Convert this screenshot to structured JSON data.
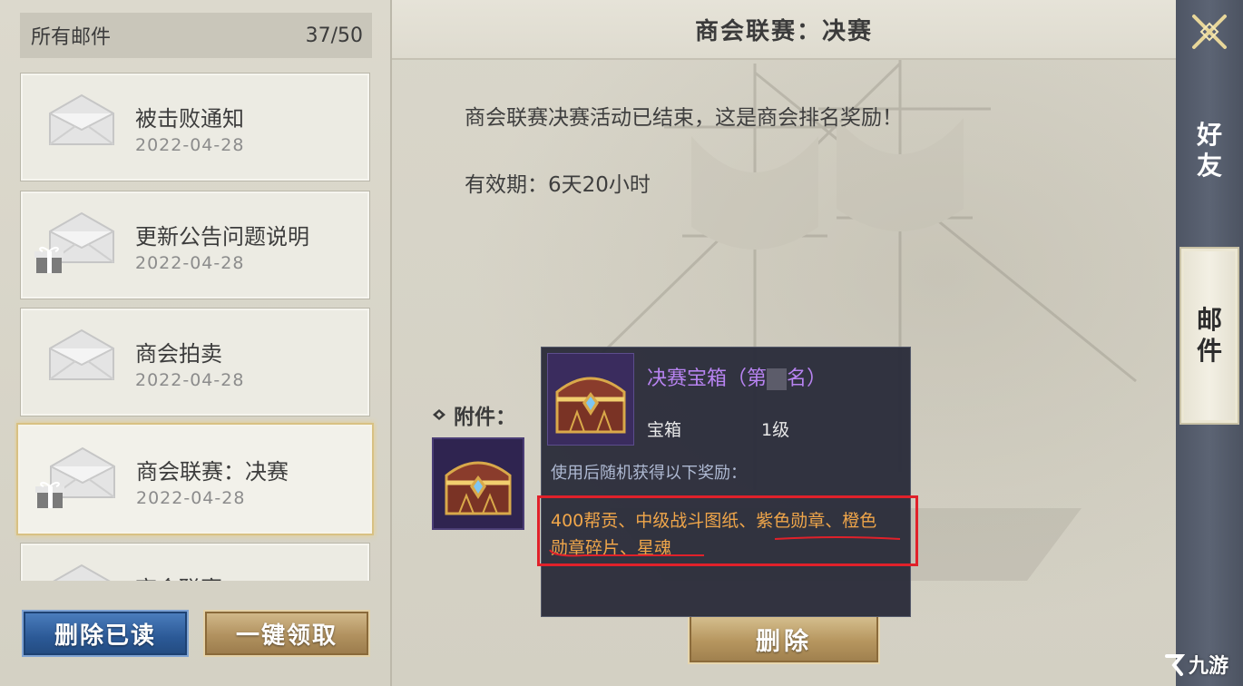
{
  "mail_list": {
    "header_title": "所有邮件",
    "count": "37/50",
    "items": [
      {
        "title": "被击败通知",
        "date": "2022-04-28",
        "has_gift": false
      },
      {
        "title": "更新公告问题说明",
        "date": "2022-04-28",
        "has_gift": true
      },
      {
        "title": "商会拍卖",
        "date": "2022-04-28",
        "has_gift": false
      },
      {
        "title": "商会联赛：决赛",
        "date": "2022-04-28",
        "has_gift": true,
        "selected": true
      },
      {
        "title": "商会联赛",
        "date": "",
        "has_gift": false
      }
    ],
    "delete_read_label": "删除已读",
    "claim_all_label": "一键领取"
  },
  "mail_detail": {
    "title": "商会联赛：决赛",
    "body": "商会联赛决赛活动已结束，这是商会排名奖励！",
    "validity": "有效期：6天20小时",
    "attachment_label": "附件：",
    "delete_label": "删除"
  },
  "tooltip": {
    "item_name_prefix": "决赛宝箱（第",
    "item_name_suffix": "名）",
    "item_type": "宝箱",
    "item_level": "1级",
    "description": "使用后随机获得以下奖励：",
    "rewards_line1": "400帮贡、中级战斗图纸、紫色勋章、橙色",
    "rewards_line2": "勋章碎片、星魂",
    "name_color": "#b783f0",
    "reward_color": "#f0a64a",
    "highlight_color": "#e0212a"
  },
  "side_tabs": {
    "friends": [
      "好",
      "友"
    ],
    "mail": [
      "邮",
      "件"
    ],
    "active": "mail"
  },
  "watermark": "九游"
}
